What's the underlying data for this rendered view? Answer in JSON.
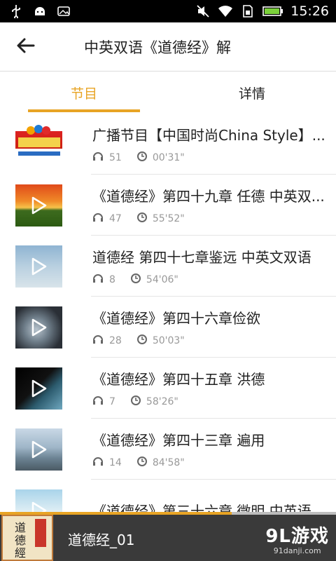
{
  "status_bar": {
    "time": "15:26",
    "left_icons": [
      "usb-icon",
      "android-debug-icon",
      "image-icon"
    ],
    "right_icons": [
      "mute-icon",
      "wifi-icon",
      "sim-icon",
      "battery-icon"
    ]
  },
  "header": {
    "title": "中英双语《道德经》解",
    "back_icon": "arrow-left-icon"
  },
  "tabs": [
    {
      "label": "节目",
      "active": true
    },
    {
      "label": "详情",
      "active": false
    }
  ],
  "colors": {
    "accent": "#e8a425",
    "text": "#222222",
    "meta": "#999999"
  },
  "items": [
    {
      "title": "广播节目【中国时尚China Style】...",
      "listens": "51",
      "duration": "00'31\""
    },
    {
      "title": "《道德经》第四十九章 任德 中英双...",
      "listens": "47",
      "duration": "55'52\""
    },
    {
      "title": "道德经 第四十七章鉴远 中英文双语",
      "listens": "8",
      "duration": "54'06\""
    },
    {
      "title": "《道德经》第四十六章俭欲",
      "listens": "28",
      "duration": "50'03\""
    },
    {
      "title": "《道德经》第四十五章 洪德",
      "listens": "7",
      "duration": "58'26\""
    },
    {
      "title": "《道德经》第四十三章 遍用",
      "listens": "14",
      "duration": "84'58\""
    },
    {
      "title": "《道德经》第三十六章 微明 中英语...",
      "listens": "",
      "duration": ""
    }
  ],
  "player": {
    "title": "道德经_01",
    "progress": 0.69,
    "cover_text": "道德經"
  },
  "watermark": {
    "brand": "9L游戏",
    "site": "91danji.com"
  }
}
